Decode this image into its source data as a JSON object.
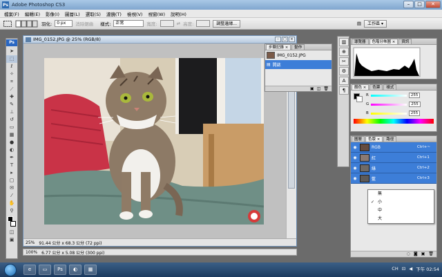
{
  "window": {
    "app_title": "Adobe Photoshop CS3",
    "app_icon": "Ps",
    "minimize": "–",
    "maximize": "□",
    "close": "✕"
  },
  "menubar": {
    "items": [
      "檔案(F)",
      "編輯(E)",
      "影像(I)",
      "圖層(L)",
      "選取(S)",
      "濾鏡(T)",
      "檢視(V)",
      "視窗(W)",
      "說明(H)"
    ]
  },
  "optionsbar": {
    "feather_label": "羽化:",
    "feather_value": "0 px",
    "antialias_label": "消除鋸齒",
    "style_label": "樣式:",
    "style_value": "正常",
    "width_label": "寬度:",
    "height_label": "高度:",
    "refine_edge": "調整邊緣...",
    "workspace_label": "工作區 ▾"
  },
  "toolbox": {
    "ps_label": "Ps"
  },
  "document": {
    "title": "IMG_0152.JPG @ 25% (RGB/8)",
    "zoom": "25%",
    "size_info": "91.44 公分 x 68.3 公分 (72 ppi)"
  },
  "statusbar": {
    "zoom": "100%",
    "size_info": "6.77 公分 x 5.08 公分 (300 ppi)"
  },
  "history_panel": {
    "tabs": [
      "步驟記錄 ×",
      "動作"
    ],
    "snapshot": "IMG_0152.JPG",
    "item": "開啟"
  },
  "histogram_panel": {
    "tabs": [
      "導覽器",
      "色階分佈圖 ×",
      "資訊"
    ]
  },
  "color_panel": {
    "tabs": [
      "顏色 ×",
      "色票",
      "樣式"
    ],
    "channels": [
      {
        "label": "R",
        "value": "255"
      },
      {
        "label": "G",
        "value": "255"
      },
      {
        "label": "B",
        "value": "255"
      }
    ]
  },
  "channels_panel": {
    "tabs": [
      "圖層",
      "色版 ×",
      "路徑"
    ],
    "rows": [
      {
        "name": "RGB",
        "shortcut": "Ctrl+~"
      },
      {
        "name": "紅",
        "shortcut": "Ctrl+1"
      },
      {
        "name": "綠",
        "shortcut": "Ctrl+2"
      },
      {
        "name": "藍",
        "shortcut": "Ctrl+3"
      }
    ]
  },
  "thumbnail_menu": {
    "items": [
      "無",
      "小",
      "中",
      "大"
    ],
    "checked": "小"
  },
  "taskbar": {
    "language": "CH",
    "clock": "下午 02:54"
  },
  "colors": {
    "selection_blue": "#3d7ed8",
    "title_blue": "#7fa6cf",
    "taskbar": "#1c3a5e"
  }
}
